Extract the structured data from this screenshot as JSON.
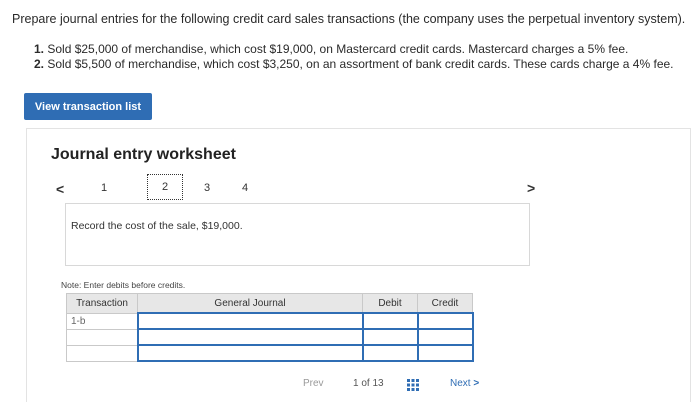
{
  "instructions": "Prepare journal entries for the following credit card sales transactions (the company uses the perpetual inventory system).",
  "items": [
    {
      "num": "1.",
      "text": "Sold $25,000 of merchandise, which cost $19,000, on Mastercard credit cards. Mastercard charges a 5% fee."
    },
    {
      "num": "2.",
      "text": "Sold $5,500 of merchandise, which cost $3,250, on an assortment of bank credit cards. These cards charge a 4% fee."
    }
  ],
  "view_button": "View transaction list",
  "worksheet": {
    "title": "Journal entry worksheet",
    "steps": [
      "1",
      "2",
      "3",
      "4"
    ],
    "prev_icon": "chevron-left-icon",
    "next_icon": "chevron-right-icon",
    "record_text": "Record the cost of the sale, $19,000.",
    "note": "Note: Enter debits before credits."
  },
  "table": {
    "headers": [
      "Transaction",
      "General Journal",
      "Debit",
      "Credit"
    ],
    "rows": [
      [
        "1-b",
        "",
        "",
        ""
      ],
      [
        "",
        "",
        "",
        ""
      ],
      [
        "",
        "",
        "",
        ""
      ]
    ]
  },
  "nav": {
    "prev": "Prev",
    "page": "1 of 13",
    "next": "Next",
    "grid_icon": "grid-icon"
  },
  "colors": {
    "accent": "#2f6db4"
  }
}
